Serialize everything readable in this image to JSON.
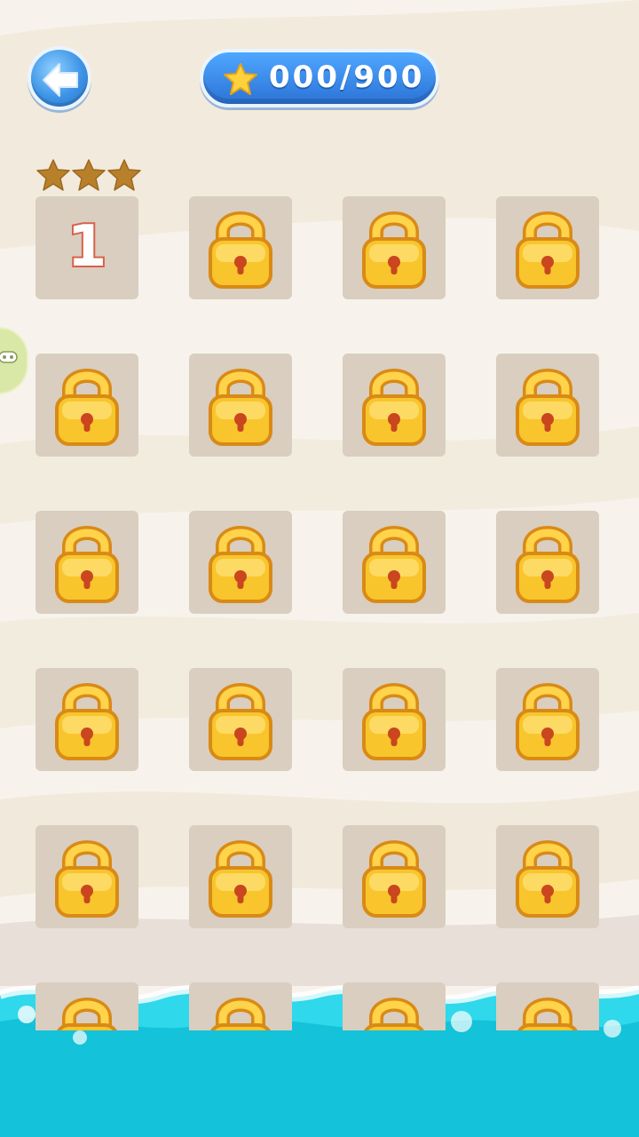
{
  "header": {
    "back_icon": "back-arrow-icon",
    "score_icon": "star-icon",
    "score_text": "000/900"
  },
  "side_tab": {
    "icon": "gamepad-icon"
  },
  "level_1": {
    "number": "1",
    "stars_earned": 0,
    "stars_max": 3
  },
  "levels": [
    {
      "label": "1",
      "locked": false
    },
    {
      "locked": true
    },
    {
      "locked": true
    },
    {
      "locked": true
    },
    {
      "locked": true
    },
    {
      "locked": true
    },
    {
      "locked": true
    },
    {
      "locked": true
    },
    {
      "locked": true
    },
    {
      "locked": true
    },
    {
      "locked": true
    },
    {
      "locked": true
    },
    {
      "locked": true
    },
    {
      "locked": true
    },
    {
      "locked": true
    },
    {
      "locked": true
    },
    {
      "locked": true
    },
    {
      "locked": true
    },
    {
      "locked": true
    },
    {
      "locked": true
    },
    {
      "locked": true
    },
    {
      "locked": true
    },
    {
      "locked": true
    },
    {
      "locked": true
    }
  ],
  "colors": {
    "tile": "#d9cebf",
    "lock_gold": "#f8c52c",
    "star_empty": "#b8802a",
    "sea": "#29d3e6",
    "button_blue": "#2b73d6"
  }
}
